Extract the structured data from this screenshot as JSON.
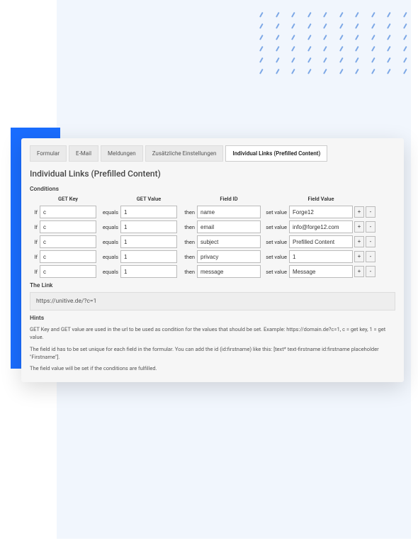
{
  "tabs": [
    "Formular",
    "E-Mail",
    "Meldungen",
    "Zusätzliche Einstellungen",
    "Individual Links (Prefilled Content)"
  ],
  "active_tab": 4,
  "section_title": "Individual Links (Prefilled Content)",
  "conditions_label": "Conditions",
  "headers": {
    "get_key": "GET Key",
    "get_value": "GET Value",
    "field_id": "Field ID",
    "field_value": "Field Value"
  },
  "labels": {
    "if": "If",
    "equals": "equals",
    "then": "then",
    "set_value": "set value",
    "plus": "+",
    "minus": "-"
  },
  "rows": [
    {
      "get_key": "c",
      "get_value": "1",
      "field_id": "name",
      "field_value": "Forge12"
    },
    {
      "get_key": "c",
      "get_value": "1",
      "field_id": "email",
      "field_value": "info@forge12.com"
    },
    {
      "get_key": "c",
      "get_value": "1",
      "field_id": "subject",
      "field_value": "Prefilled Content"
    },
    {
      "get_key": "c",
      "get_value": "1",
      "field_id": "privacy",
      "field_value": "1"
    },
    {
      "get_key": "c",
      "get_value": "1",
      "field_id": "message",
      "field_value": "Message"
    }
  ],
  "link_label": "The Link",
  "link_value": "https://unitive.de/?c=1",
  "hints_label": "Hints",
  "hints": [
    "GET Key and GET value are used in the url to be used as condition for the values that should be set. Example: https://domain.de?c=1, c = get key, 1 = get value.",
    "The field id has to be set unique for each field in the formular. You can add the id (id:firstname) like this: [text* text-firstname id:firstname placeholder \"Firstname\"].",
    "The field value will be set if the conditions are fulfilled."
  ]
}
